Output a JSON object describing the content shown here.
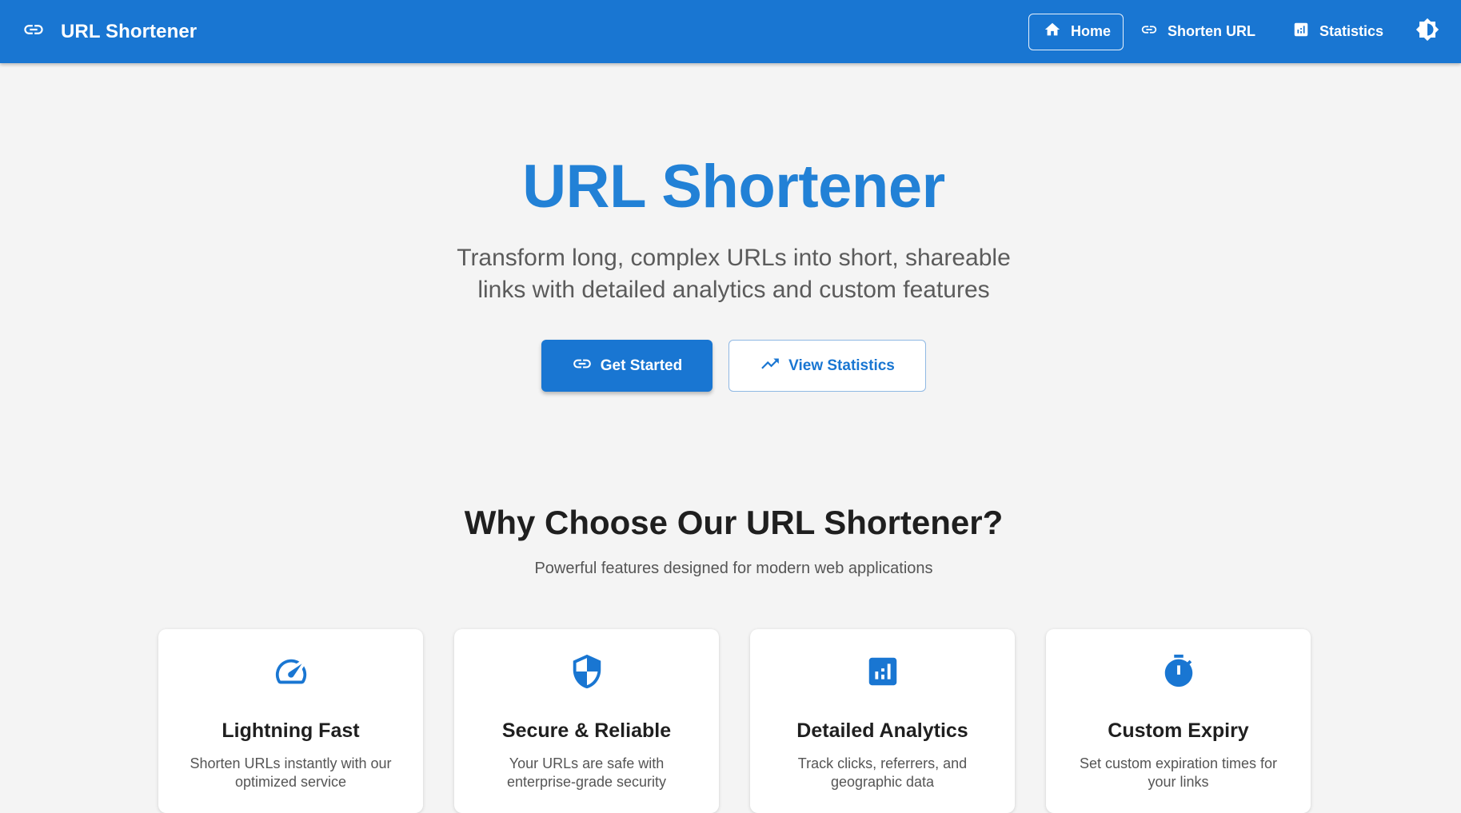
{
  "appbar": {
    "title": "URL Shortener",
    "nav": [
      {
        "label": "Home",
        "icon": "home-icon",
        "active": true
      },
      {
        "label": "Shorten URL",
        "icon": "link-icon",
        "active": false
      },
      {
        "label": "Statistics",
        "icon": "bar-chart-icon",
        "active": false
      }
    ],
    "theme_toggle_icon": "brightness-icon"
  },
  "hero": {
    "title": "URL Shortener",
    "subtitle_line1": "Transform long, complex URLs into short, shareable",
    "subtitle_line2": "links with detailed analytics and custom features",
    "primary_cta": "Get Started",
    "secondary_cta": "View Statistics"
  },
  "features": {
    "title": "Why Choose Our URL Shortener?",
    "subtitle": "Powerful features designed for modern web applications",
    "cards": [
      {
        "icon": "speedometer-icon",
        "title": "Lightning Fast",
        "text": "Shorten URLs instantly with our optimized service"
      },
      {
        "icon": "shield-icon",
        "title": "Secure & Reliable",
        "text": "Your URLs are safe with enterprise-grade security"
      },
      {
        "icon": "analytics-icon",
        "title": "Detailed Analytics",
        "text": "Track clicks, referrers, and geographic data"
      },
      {
        "icon": "timer-icon",
        "title": "Custom Expiry",
        "text": "Set custom expiration times for your links"
      }
    ]
  },
  "colors": {
    "primary": "#1976d2",
    "hero_title": "#2281d6",
    "background": "#f4f4f4"
  }
}
